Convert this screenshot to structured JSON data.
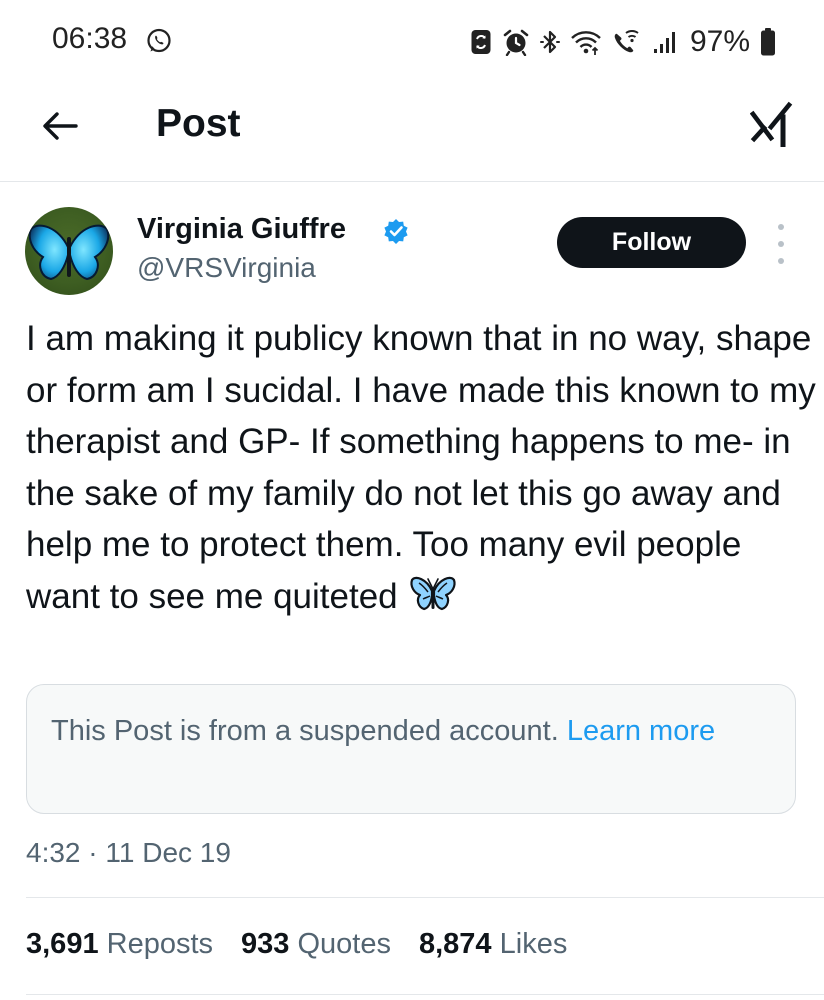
{
  "status_bar": {
    "time": "06:38",
    "battery": "97%",
    "icons": [
      "whatsapp-icon",
      "sync-icon",
      "alarm-icon",
      "bluetooth-icon",
      "wifi-icon",
      "wifi-calling-icon",
      "signal-icon",
      "battery-icon"
    ]
  },
  "header": {
    "title": "Post",
    "back_icon": "arrow-left-icon",
    "grok_icon": "grok-icon"
  },
  "post": {
    "author_name": "Virginia Giuffre",
    "author_handle": "@VRSVirginia",
    "verified": true,
    "follow_label": "Follow",
    "text": "I am making it publicy known that in no way, shape or form am I sucidal. I have made this known to my therapist and GP- If something happens to me- in the sake of my family do not let this go away and help me to protect them. Too many evil people want to see me quiteted",
    "emoji": "butterfly",
    "notice_text": "This Post is from a suspended account. ",
    "notice_link": "Learn more",
    "timestamp": "4:32 · 11 Dec 19"
  },
  "stats": [
    {
      "value": "3,691",
      "label": "Reposts"
    },
    {
      "value": "933",
      "label": "Quotes"
    },
    {
      "value": "8,874",
      "label": "Likes"
    }
  ],
  "colors": {
    "text": "#0f1419",
    "secondary": "#536471",
    "link": "#1d9bf0",
    "verified": "#1d9bf0",
    "follow_bg": "#0f1419"
  }
}
